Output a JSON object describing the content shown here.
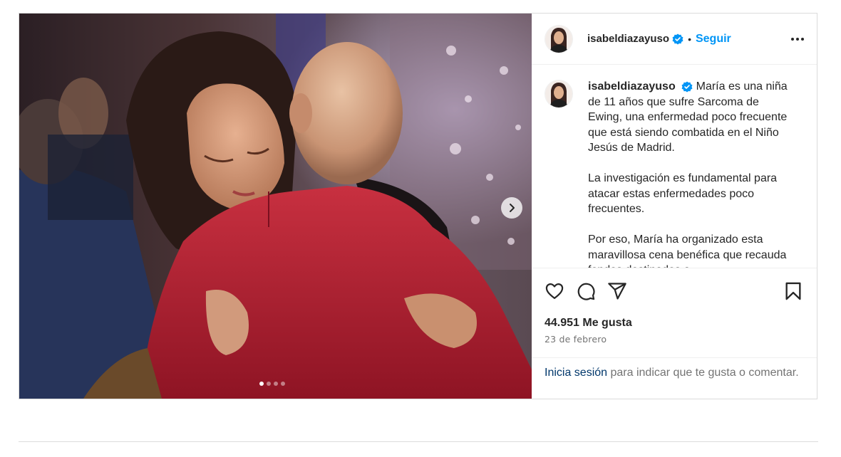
{
  "post": {
    "username": "isabeldiazayuso",
    "separator": "•",
    "follow_label": "Seguir",
    "more_icon": "more-horizontal-icon",
    "verified_color": "#0095f6",
    "media": {
      "image_count": 4,
      "active_index": 1,
      "next_icon": "chevron-right-icon"
    },
    "caption": {
      "paragraphs": [
        "María es una niña de 11 años que sufre Sarcoma de Ewing, una enfermedad poco frecuente que está siendo combatida en el Niño Jesús de Madrid.",
        "La investigación es fundamental para atacar estas enfermedades poco frecuentes.",
        "Por eso, María ha organizado esta maravillosa cena benéfica que recauda fondos destinados a"
      ]
    },
    "actions": {
      "like_icon": "heart-icon",
      "comment_icon": "comment-icon",
      "share_icon": "send-icon",
      "save_icon": "bookmark-icon"
    },
    "likes_text": "44.951 Me gusta",
    "date_text": "23 de febrero",
    "login_prompt": {
      "link": "Inicia sesión",
      "rest": " para indicar que te gusta o comentar."
    }
  }
}
